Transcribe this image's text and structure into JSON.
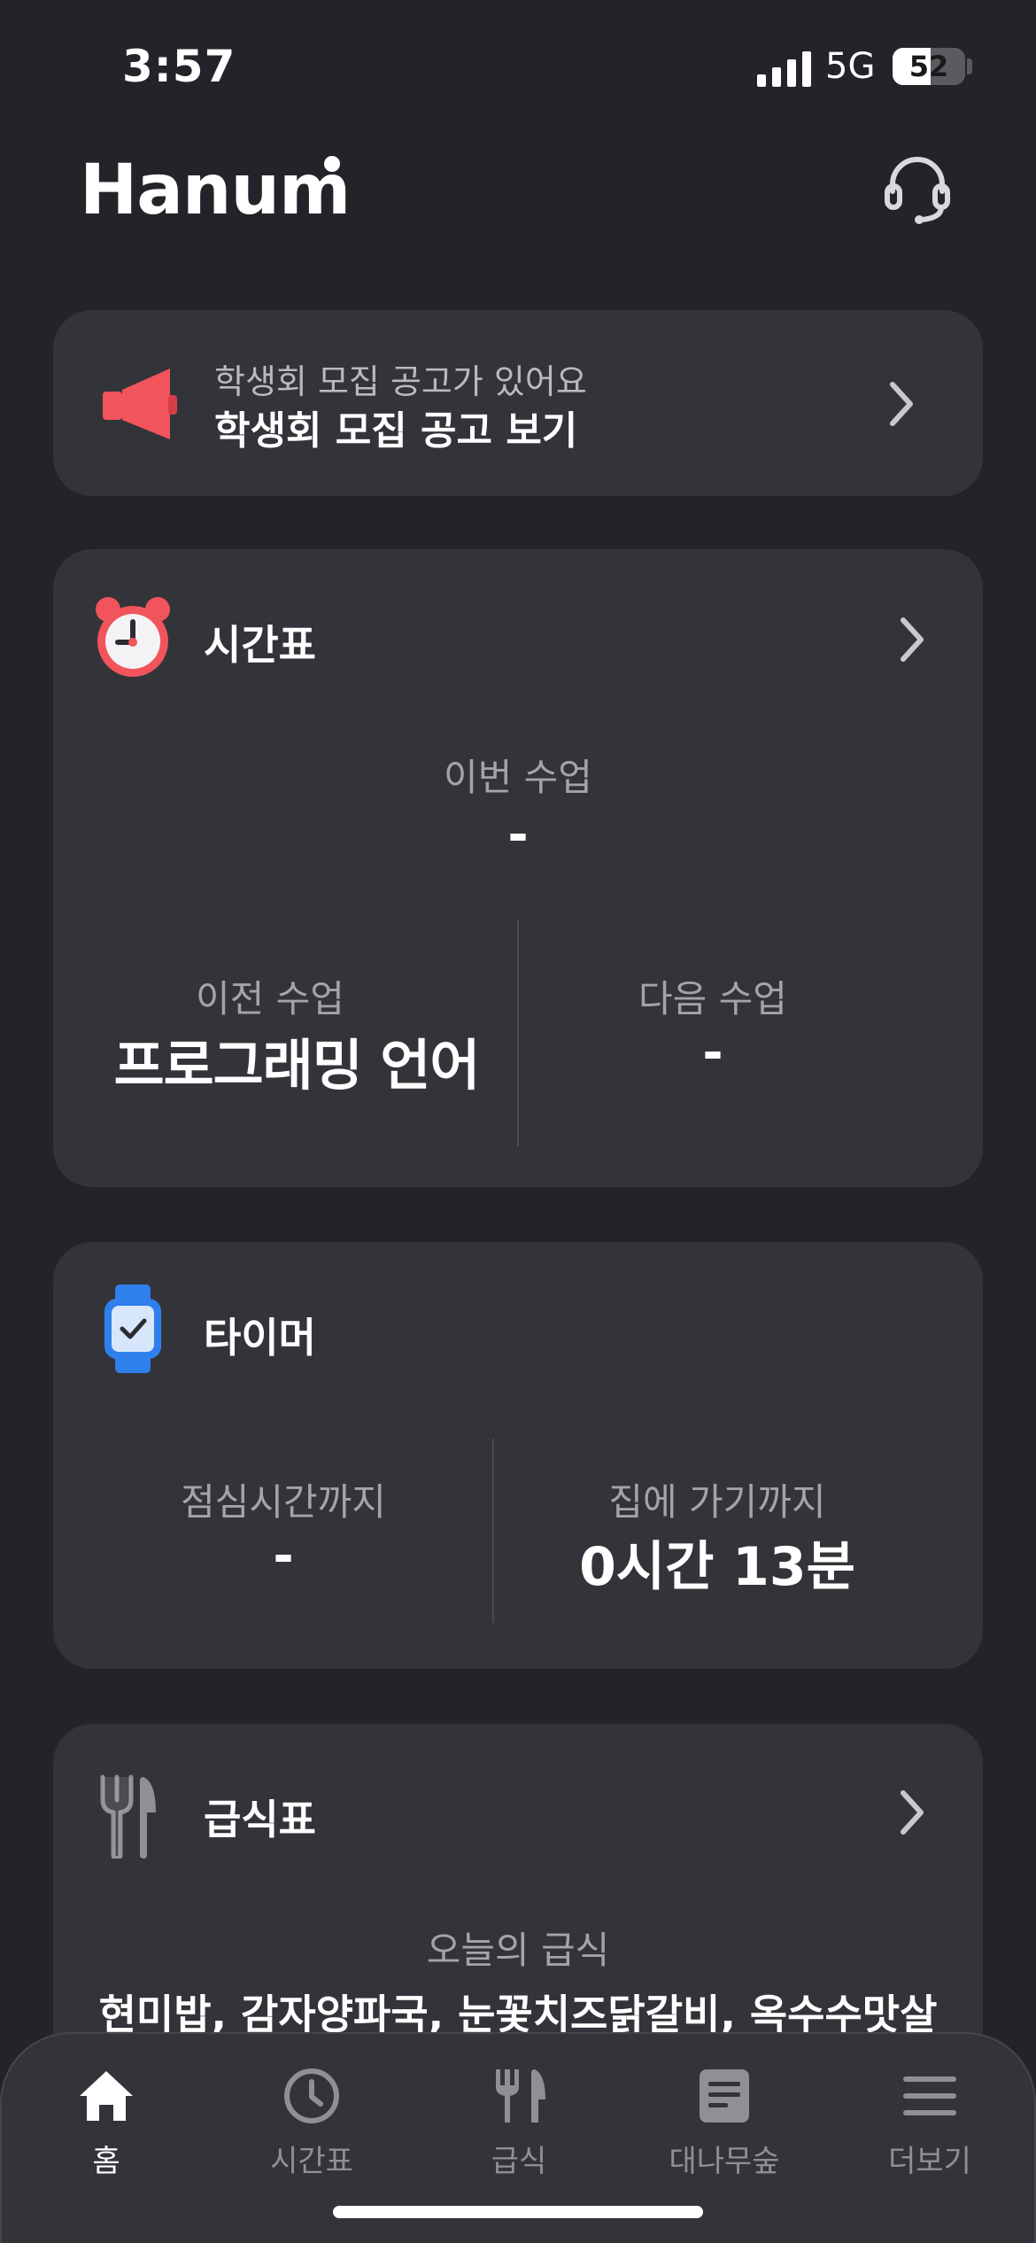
{
  "status_bar": {
    "time": "3:57",
    "network": "5G",
    "battery": "52",
    "battery_fraction": 0.52
  },
  "header": {
    "logo": "Hanum"
  },
  "notice": {
    "subtitle": "학생회 모집 공고가 있어요",
    "title": "학생회 모집 공고 보기"
  },
  "timetable": {
    "title": "시간표",
    "current_label": "이번 수업",
    "current_value": "-",
    "prev_label": "이전 수업",
    "prev_value": "프로그래밍 언어",
    "next_label": "다음 수업",
    "next_value": "-"
  },
  "timer": {
    "title": "타이머",
    "lunch_label": "점심시간까지",
    "lunch_value": "-",
    "home_label": "집에 가기까지",
    "home_value": "0시간 13분"
  },
  "meal": {
    "title": "급식표",
    "today_label": "오늘의 급식",
    "menu": "현미밥, 감자양파국, 눈꽃치즈닭갈비, 옥수수맛살"
  },
  "tabs": [
    {
      "label": "홈",
      "icon": "home-icon",
      "active": true
    },
    {
      "label": "시간표",
      "icon": "clock-icon",
      "active": false
    },
    {
      "label": "급식",
      "icon": "utensils-icon",
      "active": false
    },
    {
      "label": "대나무숲",
      "icon": "document-icon",
      "active": false
    },
    {
      "label": "더보기",
      "icon": "menu-icon",
      "active": false
    }
  ],
  "colors": {
    "background": "#232429",
    "card": "#333439",
    "accent_red": "#f2545b",
    "accent_blue": "#2f80ed"
  }
}
